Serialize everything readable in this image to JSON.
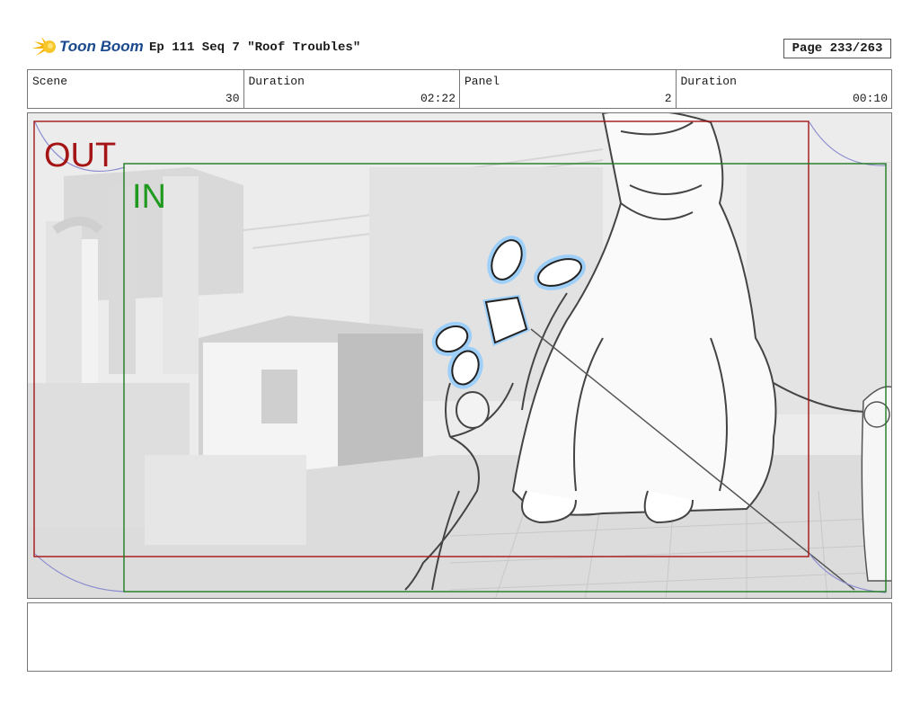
{
  "header": {
    "logo_text": "Toon Boom",
    "episode_title": "Ep 111 Seq 7 \"Roof Troubles\"",
    "page": "Page 233/263"
  },
  "info": {
    "scene_label": "Scene",
    "scene_value": "30",
    "scene_duration_label": "Duration",
    "scene_duration_value": "02:22",
    "panel_label": "Panel",
    "panel_value": "2",
    "panel_duration_label": "Duration",
    "panel_duration_value": "00:10"
  },
  "panel": {
    "out_label": "OUT",
    "in_label": "IN",
    "out_color": "#a51515",
    "in_color": "#1f9a1f"
  },
  "notes": {
    "text": ""
  }
}
